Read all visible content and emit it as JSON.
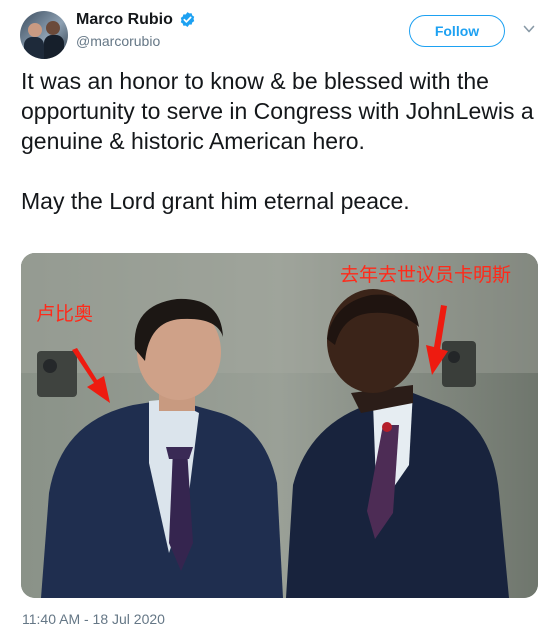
{
  "header": {
    "name": "Marco Rubio",
    "handle": "@marcorubio",
    "follow_label": "Follow"
  },
  "tweet": {
    "text": "It was an honor to know & be blessed with the opportunity to serve in Congress with JohnLewis a genuine & historic American hero.\n\nMay the Lord grant him eternal peace.",
    "timestamp": "11:40 AM - 18 Jul 2020"
  },
  "photo": {
    "annotation_left": "卢比奥",
    "annotation_right": "去年去世议员卡明斯"
  },
  "colors": {
    "accent": "#1da1f2",
    "annotation": "#ff2a1a"
  }
}
